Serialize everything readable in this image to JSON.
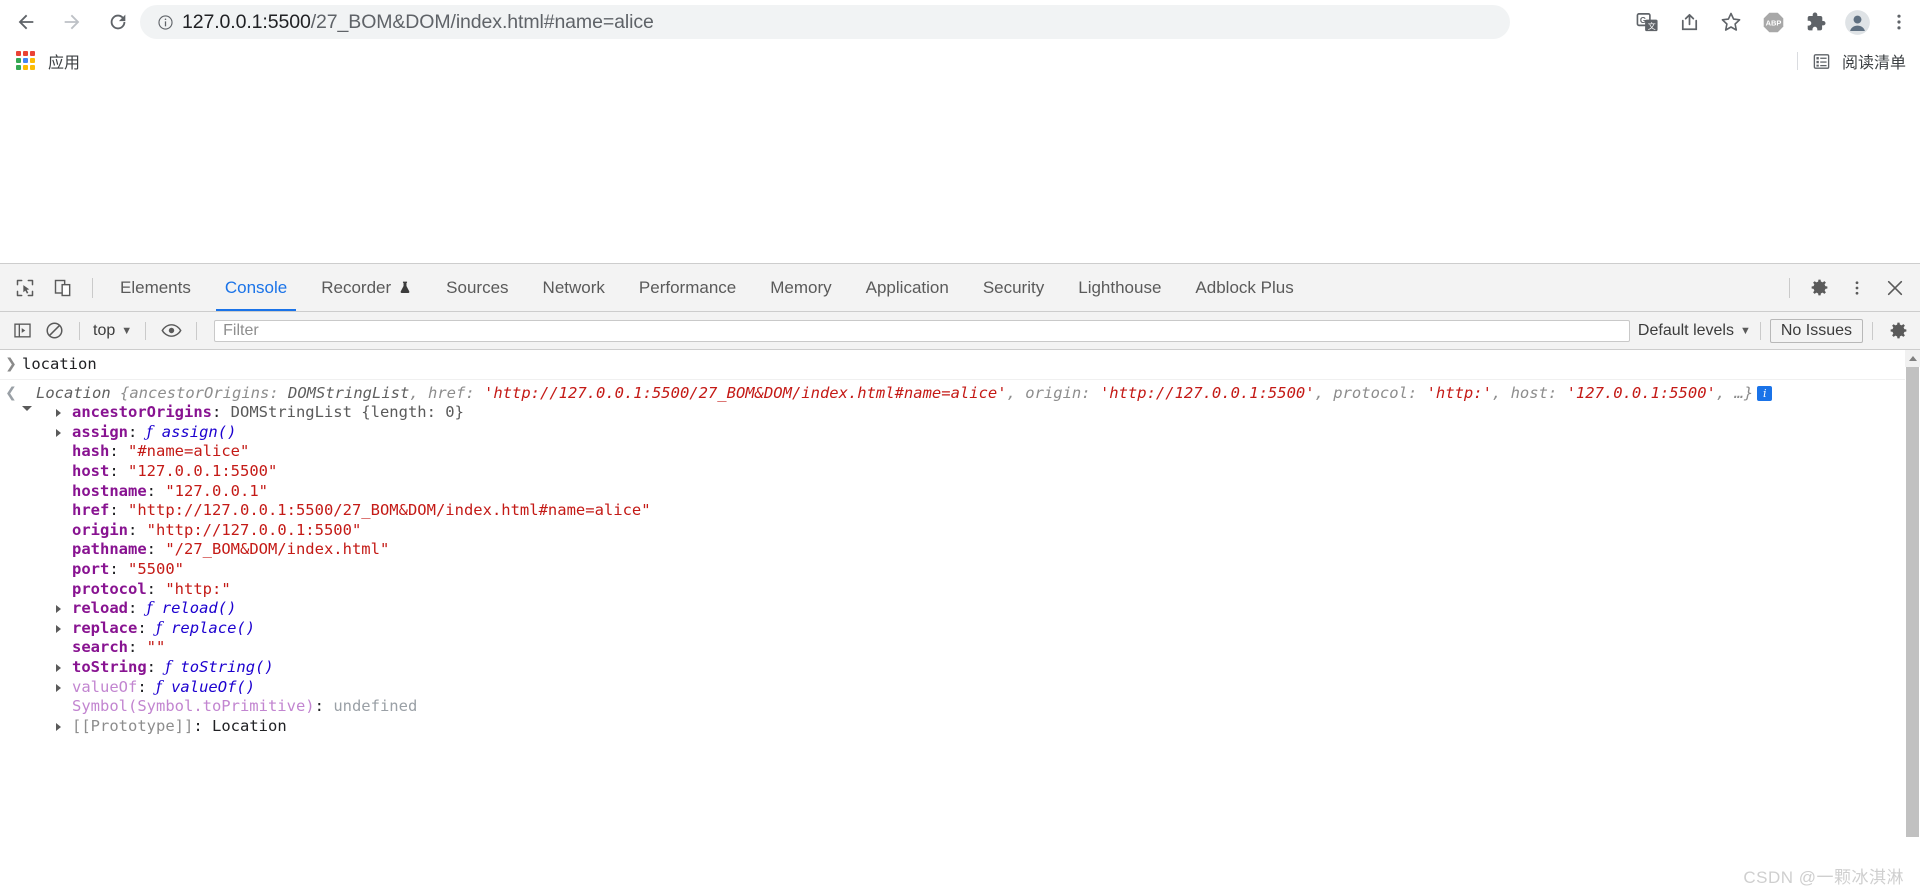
{
  "browser": {
    "nav": {
      "back_label": "Back",
      "forward_label": "Forward",
      "reload_label": "Reload"
    },
    "omnibox": {
      "site_info_icon": "info-circle-icon",
      "host": "127.0.0.1:5500",
      "path": "/27_BOM&DOM/index.html#name=alice",
      "full_url": "127.0.0.1:5500/27_BOM&DOM/index.html#name=alice"
    },
    "toolbar_icons": [
      {
        "name": "translate-icon",
        "label": "Translate"
      },
      {
        "name": "share-icon",
        "label": "Share this page"
      },
      {
        "name": "bookmark-star-icon",
        "label": "Bookmark this tab"
      },
      {
        "name": "adblock-plus-icon",
        "label": "ABP"
      },
      {
        "name": "extensions-puzzle-icon",
        "label": "Extensions"
      },
      {
        "name": "profile-avatar-icon",
        "label": "Profile"
      },
      {
        "name": "chrome-menu-icon",
        "label": "Customize and control Google Chrome"
      }
    ],
    "bookmarks_bar": {
      "apps_label": "应用",
      "apps_icon": "apps-grid-icon",
      "reading_list_label": "阅读清单",
      "reading_list_icon": "reading-list-icon"
    }
  },
  "devtools": {
    "left_tools": [
      {
        "name": "inspect-element-icon",
        "label": "Inspect element"
      },
      {
        "name": "device-toolbar-icon",
        "label": "Toggle device toolbar"
      }
    ],
    "tabs": [
      {
        "label": "Elements",
        "active": false,
        "badge": null
      },
      {
        "label": "Console",
        "active": true,
        "badge": null
      },
      {
        "label": "Recorder",
        "active": false,
        "badge": "flask-icon"
      },
      {
        "label": "Sources",
        "active": false,
        "badge": null
      },
      {
        "label": "Network",
        "active": false,
        "badge": null
      },
      {
        "label": "Performance",
        "active": false,
        "badge": null
      },
      {
        "label": "Memory",
        "active": false,
        "badge": null
      },
      {
        "label": "Application",
        "active": false,
        "badge": null
      },
      {
        "label": "Security",
        "active": false,
        "badge": null
      },
      {
        "label": "Lighthouse",
        "active": false,
        "badge": null
      },
      {
        "label": "Adblock Plus",
        "active": false,
        "badge": null
      }
    ],
    "tabbar_right_icons": [
      {
        "name": "settings-gear-icon",
        "label": "Settings"
      },
      {
        "name": "more-options-icon",
        "label": "Customize and control DevTools"
      },
      {
        "name": "close-devtools-icon",
        "label": "Close DevTools"
      }
    ],
    "console_toolbar": {
      "sidebar_toggle_icon": "console-sidebar-icon",
      "clear_console_icon": "clear-console-icon",
      "context_selector": "top",
      "context_caret": "▼",
      "eye_icon": "live-expression-eye-icon",
      "filter_placeholder": "Filter",
      "filter_value": "",
      "levels_label": "Default levels",
      "levels_caret": "▼",
      "issues_label": "No Issues",
      "settings_icon": "console-settings-gear-icon"
    }
  },
  "console": {
    "input_prompt_icon": "prompt-chevron-right",
    "command": "location",
    "result_prompt_icon": "result-chevron-left",
    "preview": {
      "class_name": "Location",
      "open_brace": "{",
      "entries": [
        {
          "key": "ancestorOrigins",
          "sep": ": ",
          "value": "DOMStringList",
          "kind": "obj"
        },
        {
          "key": "href",
          "sep": ": ",
          "value": "'http://127.0.0.1:5500/27_BOM&DOM/index.html#name=alice'",
          "kind": "str"
        },
        {
          "key": "origin",
          "sep": ": ",
          "value": "'http://127.0.0.1:5500'",
          "kind": "str"
        },
        {
          "key": "protocol",
          "sep": ": ",
          "value": "'http:'",
          "kind": "str"
        },
        {
          "key": "host",
          "sep": ": ",
          "value": "'127.0.0.1:5500'",
          "kind": "str"
        }
      ],
      "ellipsis": ", …}",
      "info_badge": "i"
    },
    "properties": [
      {
        "expandable": true,
        "key": "ancestorOrigins",
        "dim": false,
        "value": "DOMStringList {length: 0}",
        "kind": "obj-len"
      },
      {
        "expandable": true,
        "key": "assign",
        "dim": false,
        "value": "assign()",
        "kind": "fn"
      },
      {
        "expandable": false,
        "key": "hash",
        "dim": false,
        "value": "\"#name=alice\"",
        "kind": "str"
      },
      {
        "expandable": false,
        "key": "host",
        "dim": false,
        "value": "\"127.0.0.1:5500\"",
        "kind": "str"
      },
      {
        "expandable": false,
        "key": "hostname",
        "dim": false,
        "value": "\"127.0.0.1\"",
        "kind": "str"
      },
      {
        "expandable": false,
        "key": "href",
        "dim": false,
        "value": "\"http://127.0.0.1:5500/27_BOM&DOM/index.html#name=alice\"",
        "kind": "str"
      },
      {
        "expandable": false,
        "key": "origin",
        "dim": false,
        "value": "\"http://127.0.0.1:5500\"",
        "kind": "str"
      },
      {
        "expandable": false,
        "key": "pathname",
        "dim": false,
        "value": "\"/27_BOM&DOM/index.html\"",
        "kind": "str"
      },
      {
        "expandable": false,
        "key": "port",
        "dim": false,
        "value": "\"5500\"",
        "kind": "str"
      },
      {
        "expandable": false,
        "key": "protocol",
        "dim": false,
        "value": "\"http:\"",
        "kind": "str"
      },
      {
        "expandable": true,
        "key": "reload",
        "dim": false,
        "value": "reload()",
        "kind": "fn"
      },
      {
        "expandable": true,
        "key": "replace",
        "dim": false,
        "value": "replace()",
        "kind": "fn"
      },
      {
        "expandable": false,
        "key": "search",
        "dim": false,
        "value": "\"\"",
        "kind": "str"
      },
      {
        "expandable": true,
        "key": "toString",
        "dim": false,
        "value": "toString()",
        "kind": "fn"
      },
      {
        "expandable": true,
        "key": "valueOf",
        "dim": true,
        "value": "valueOf()",
        "kind": "fn"
      },
      {
        "expandable": false,
        "key": "Symbol(Symbol.toPrimitive)",
        "dim": true,
        "value": "undefined",
        "kind": "undef"
      },
      {
        "expandable": true,
        "key": "[[Prototype]]",
        "dim": false,
        "proto": true,
        "value": "Location",
        "kind": "proto"
      }
    ]
  },
  "watermark": "CSDN @一颗冰淇淋",
  "colors": {
    "accent_blue": "#1a73e8",
    "string_red": "#c41a16",
    "property_purple": "#881391",
    "number_blue": "#1c00cf",
    "toolbar_grey": "#f3f3f3"
  }
}
